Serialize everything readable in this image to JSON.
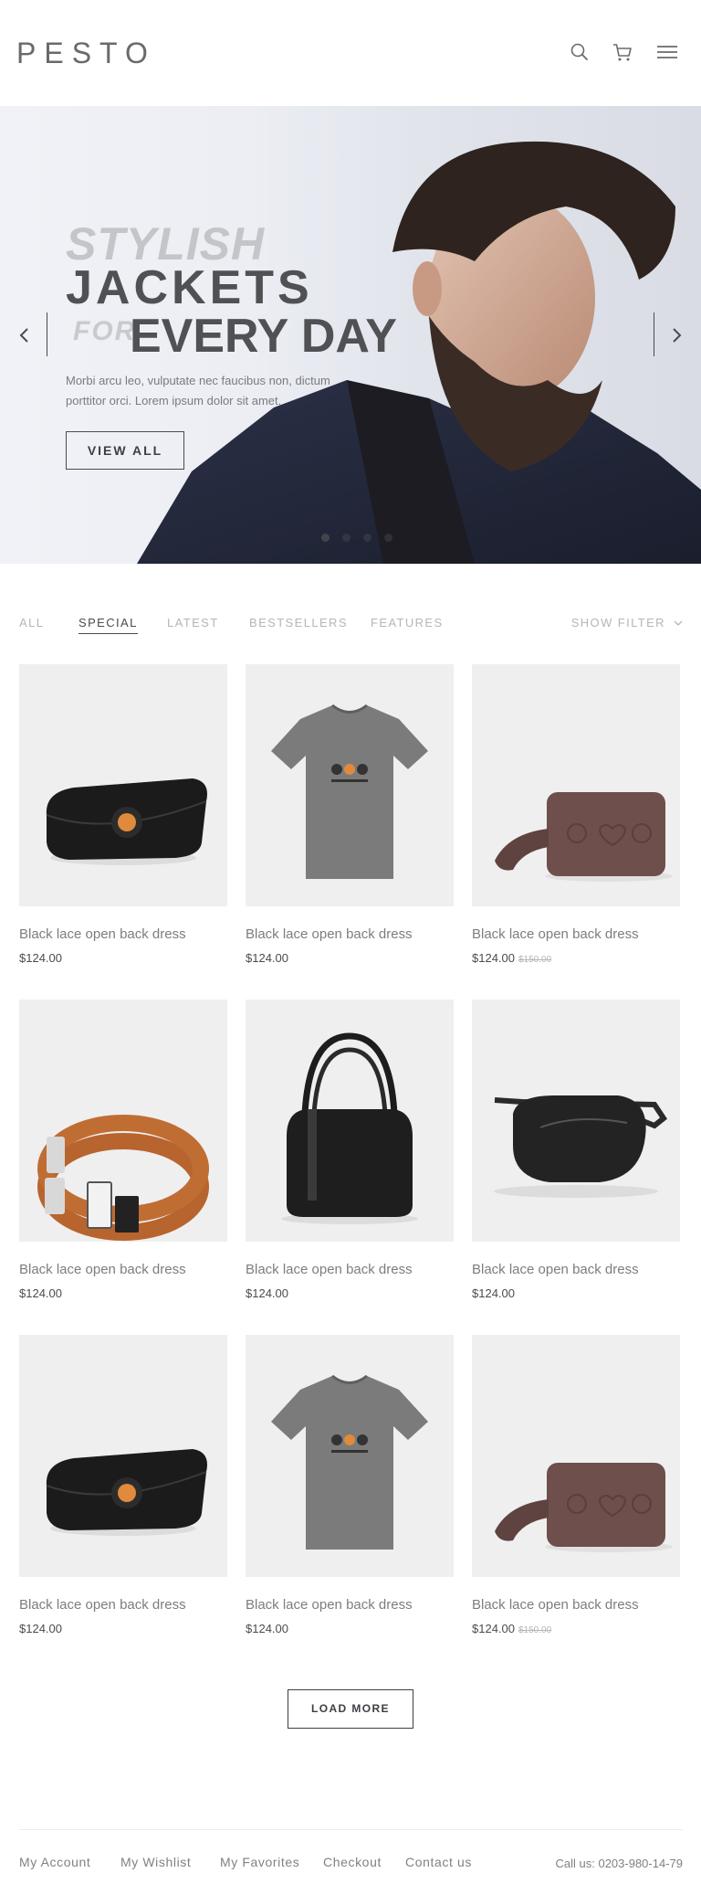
{
  "header": {
    "logo": "PESTO",
    "icons": [
      "search-icon",
      "cart-icon",
      "menu-icon"
    ]
  },
  "hero": {
    "line1": "STYLISH",
    "line2": "JACKETS",
    "line3_small": "FOR",
    "line3": "EVERY DAY",
    "description": "Morbi arcu leo, vulputate nec faucibus non, dictum porttitor orci. Lorem ipsum dolor sit amet.",
    "button": "VIEW ALL",
    "slides": 4,
    "active_slide": 1
  },
  "tabs": {
    "items": [
      "ALL",
      "SPECIAL",
      "LATEST",
      "BESTSELLERS",
      "FEATURES"
    ],
    "active": "SPECIAL",
    "show_filter": "SHOW FILTER"
  },
  "products": [
    {
      "title": "Black lace open back dress",
      "price": "$124.00",
      "old_price": "",
      "image": "black-clutch"
    },
    {
      "title": "Black lace open back dress",
      "price": "$124.00",
      "old_price": "",
      "image": "grey-tshirt"
    },
    {
      "title": "Black lace open back dress",
      "price": "$124.00",
      "old_price": "$150.00",
      "image": "brown-luggage-tag"
    },
    {
      "title": "Black lace open back dress",
      "price": "$124.00",
      "old_price": "",
      "image": "brown-leather-belt"
    },
    {
      "title": "Black lace open back dress",
      "price": "$124.00",
      "old_price": "",
      "image": "black-handbag"
    },
    {
      "title": "Black lace open back dress",
      "price": "$124.00",
      "old_price": "",
      "image": "black-waist-bag"
    },
    {
      "title": "Black lace open back dress",
      "price": "$124.00",
      "old_price": "",
      "image": "black-clutch"
    },
    {
      "title": "Black lace open back dress",
      "price": "$124.00",
      "old_price": "",
      "image": "grey-tshirt"
    },
    {
      "title": "Black lace open back dress",
      "price": "$124.00",
      "old_price": "$150.00",
      "image": "brown-luggage-tag"
    }
  ],
  "load_more": "LOAD MORE",
  "footer": {
    "links": [
      "My Account",
      "My Wishlist",
      "My Favorites",
      "Checkout",
      "Contact us"
    ],
    "call": "Call us: 0203-980-14-79"
  },
  "colors": {
    "text_dark": "#4a4b50",
    "text_muted": "#b5b6ba",
    "product_bg": "#efefef"
  }
}
